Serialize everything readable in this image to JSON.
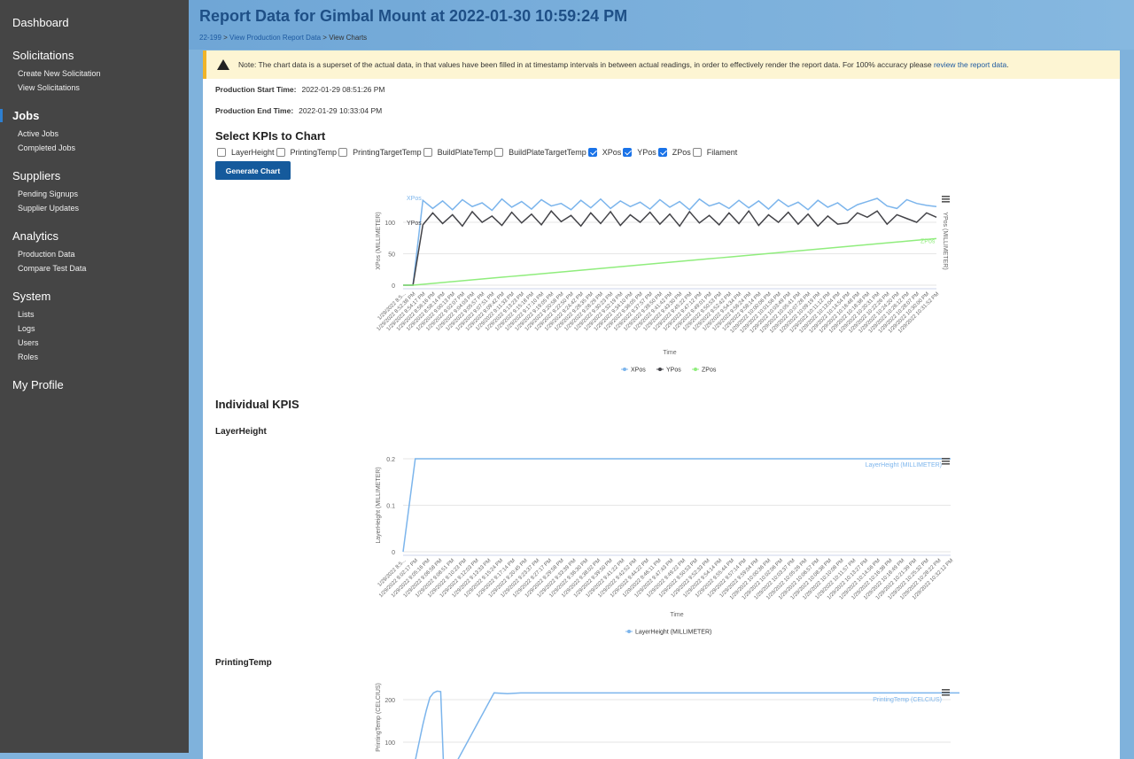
{
  "sidebar": {
    "dashboard": "Dashboard",
    "sections": [
      {
        "title": "Solicitations",
        "items": [
          "Create New Solicitation",
          "View Solicitations"
        ]
      },
      {
        "title": "Jobs",
        "items": [
          "Active Jobs",
          "Completed Jobs"
        ]
      },
      {
        "title": "Suppliers",
        "items": [
          "Pending Signups",
          "Supplier Updates"
        ]
      },
      {
        "title": "Analytics",
        "items": [
          "Production Data",
          "Compare Test Data"
        ]
      },
      {
        "title": "System",
        "items": [
          "Lists",
          "Logs",
          "Users",
          "Roles"
        ]
      }
    ],
    "profile": "My Profile"
  },
  "header": {
    "title": "Report Data for Gimbal Mount at 2022-01-30 10:59:24 PM",
    "breadcrumb": [
      "22-199",
      "View Production Report Data",
      "View Charts"
    ],
    "sep": " > "
  },
  "note": {
    "text": "Note: The chart data is a superset of the actual data, in that values have been filled in at timestamp intervals in between actual readings, in order to effectively render the report data. For 100% accuracy please ",
    "link": "review the report data",
    "end": "."
  },
  "production": {
    "start_label": "Production Start Time:",
    "start": "2022-01-29 08:51:26 PM",
    "end_label": "Production End Time:",
    "end": "2022-01-29 10:33:04 PM"
  },
  "kpi_select": {
    "title": "Select KPIs to Chart",
    "options": [
      {
        "label": "LayerHeight",
        "checked": false
      },
      {
        "label": "PrintingTemp",
        "checked": false
      },
      {
        "label": "PrintingTargetTemp",
        "checked": false
      },
      {
        "label": "BuildPlateTemp",
        "checked": false
      },
      {
        "label": "BuildPlateTargetTemp",
        "checked": false
      },
      {
        "label": "XPos",
        "checked": true
      },
      {
        "label": "YPos",
        "checked": true
      },
      {
        "label": "ZPos",
        "checked": true
      },
      {
        "label": "Filament",
        "checked": false
      }
    ],
    "button": "Generate Chart"
  },
  "individual_title": "Individual KPIS",
  "sections": {
    "layer": "LayerHeight",
    "ptemp": "PrintingTemp"
  },
  "chart_data": [
    {
      "type": "line",
      "xlabel": "Time",
      "ylabel": "XPos (MILLIMETER)",
      "ylabel_right": "YPos (MILLIMETER)",
      "yticks": [
        0,
        50,
        100
      ],
      "ylim": [
        0,
        140
      ],
      "grid": true,
      "legend": "bottom",
      "categories": [
        "1/29/2022 8:5...",
        "1/29/2022 8:52:38 PM",
        "1/29/2022 8:54:17 PM",
        "1/29/2022 8:56:16 PM",
        "1/29/2022 8:58:14 PM",
        "1/29/2022 9:00:13 PM",
        "1/29/2022 9:02:07 PM",
        "1/29/2022 9:04:03 PM",
        "1/29/2022 9:05:57 PM",
        "1/29/2022 9:07:51 PM",
        "1/29/2022 9:09:42 PM",
        "1/29/2022 9:11:33 PM",
        "1/29/2022 9:13:23 PM",
        "1/29/2022 9:15:18 PM",
        "1/29/2022 9:17:10 PM",
        "1/29/2022 9:19:05 PM",
        "1/29/2022 9:20:58 PM",
        "1/29/2022 9:22:50 PM",
        "1/29/2022 9:24:42 PM",
        "1/29/2022 9:26:35 PM",
        "1/29/2022 9:28:29 PM",
        "1/29/2022 9:30:23 PM",
        "1/29/2022 9:32:19 PM",
        "1/29/2022 9:34:10 PM",
        "1/29/2022 9:36:05 PM",
        "1/29/2022 9:37:57 PM",
        "1/29/2022 9:39:50 PM",
        "1/29/2022 9:41:42 PM",
        "1/29/2022 9:43:30 PM",
        "1/29/2022 9:45:22 PM",
        "1/29/2022 9:47:12 PM",
        "1/29/2022 9:49:01 PM",
        "1/29/2022 9:50:53 PM",
        "1/29/2022 9:52:42 PM",
        "1/29/2022 9:54:34 PM",
        "1/29/2022 9:56:24 PM",
        "1/29/2022 9:58:14 PM",
        "1/29/2022 10:00:06 PM",
        "1/29/2022 10:01:56 PM",
        "1/29/2022 10:03:49 PM",
        "1/29/2022 10:05:41 PM",
        "1/29/2022 10:07:28 PM",
        "1/29/2022 10:09:19 PM",
        "1/29/2022 10:11:12 PM",
        "1/29/2022 10:13:04 PM",
        "1/29/2022 10:14:54 PM",
        "1/29/2022 10:16:48 PM",
        "1/29/2022 10:18:38 PM",
        "1/29/2022 10:20:31 PM",
        "1/29/2022 10:22:26 PM",
        "1/29/2022 10:24:20 PM",
        "1/29/2022 10:26:12 PM",
        "1/29/2022 10:28:07 PM",
        "1/29/2022 10:30:00 PM",
        "1/29/2022 10:31:52 PM"
      ],
      "series": [
        {
          "name": "XPos",
          "color": "#7cb5ec",
          "values": [
            0,
            0,
            135,
            122,
            134,
            120,
            136,
            125,
            131,
            119,
            137,
            124,
            133,
            121,
            136,
            126,
            130,
            120,
            135,
            123,
            137,
            122,
            134,
            125,
            132,
            121,
            136,
            124,
            133,
            120,
            137,
            126,
            131,
            122,
            135,
            123,
            134,
            121,
            136,
            125,
            132,
            120,
            135,
            124,
            131,
            119,
            128,
            133,
            138,
            126,
            122,
            136,
            130,
            127,
            125
          ]
        },
        {
          "name": "YPos",
          "color": "#434348",
          "values": [
            0,
            0,
            96,
            115,
            98,
            112,
            94,
            117,
            100,
            110,
            95,
            116,
            99,
            113,
            96,
            118,
            101,
            111,
            94,
            115,
            98,
            117,
            95,
            112,
            100,
            116,
            97,
            113,
            94,
            117,
            99,
            111,
            96,
            115,
            98,
            118,
            95,
            112,
            100,
            116,
            97,
            113,
            94,
            110,
            97,
            99,
            115,
            108,
            118,
            97,
            112,
            106,
            100,
            115,
            108
          ]
        },
        {
          "name": "ZPos",
          "color": "#90ed7d",
          "values": [
            0,
            0,
            1.4,
            2.8,
            4.2,
            5.6,
            7,
            8.4,
            9.8,
            11.2,
            12.6,
            14,
            15.4,
            16.8,
            18.2,
            19.6,
            21,
            22.4,
            23.8,
            25.2,
            26.6,
            28,
            29.4,
            30.8,
            32.2,
            33.6,
            35,
            36.4,
            37.8,
            39.2,
            40.6,
            42,
            43.4,
            44.8,
            46.2,
            47.6,
            49,
            50.4,
            51.8,
            53.2,
            54.6,
            56,
            57.4,
            58.8,
            60.2,
            61.6,
            63,
            64.4,
            65.8,
            67.2,
            68.6,
            70,
            71.4,
            72.8,
            74.2
          ]
        }
      ]
    },
    {
      "type": "line",
      "xlabel": "Time",
      "ylabel": "LayerHeight (MILLIMETER)",
      "yticks": [
        0,
        0.1,
        0.2
      ],
      "ylim": [
        0,
        0.2
      ],
      "grid": true,
      "legend": "bottom",
      "categories": [
        "1/29/2022 8:5...",
        "1/29/2022 9:02:17 PM",
        "1/29/2022 9:05:16 PM",
        "1/29/2022 9:06:58 PM",
        "1/29/2022 9:08:51 PM",
        "1/29/2022 9:10:23 PM",
        "1/29/2022 9:12:03 PM",
        "1/29/2022 9:13:33 PM",
        "1/29/2022 9:15:24 PM",
        "1/29/2022 9:17:14 PM",
        "1/29/2022 9:20:45 PM",
        "1/29/2022 9:23:37 PM",
        "1/29/2022 9:27:17 PM",
        "1/29/2022 9:29:58 PM",
        "1/29/2022 9:33:39 PM",
        "1/29/2022 9:36:30 PM",
        "1/29/2022 9:38:02 PM",
        "1/29/2022 9:39:50 PM",
        "1/29/2022 9:41:22 PM",
        "1/29/2022 9:42:52 PM",
        "1/29/2022 9:44:22 PM",
        "1/29/2022 9:46:11 PM",
        "1/29/2022 9:47:43 PM",
        "1/29/2022 9:49:22 PM",
        "1/29/2022 9:50:53 PM",
        "1/29/2022 9:52:33 PM",
        "1/29/2022 9:54:14 PM",
        "1/29/2022 9:55:44 PM",
        "1/29/2022 9:57:14 PM",
        "1/29/2022 9:59:04 PM",
        "1/29/2022 10:00:36 PM",
        "1/29/2022 10:02:06 PM",
        "1/29/2022 10:03:37 PM",
        "1/29/2022 10:05:26 PM",
        "1/29/2022 10:06:57 PM",
        "1/29/2022 10:08:38 PM",
        "1/29/2022 10:10:08 PM",
        "1/29/2022 10:11:57 PM",
        "1/29/2022 10:13:27 PM",
        "1/29/2022 10:14:56 PM",
        "1/29/2022 10:16:38 PM",
        "1/29/2022 10:18:49 PM",
        "1/29/2022 10:21:39 PM",
        "1/29/2022 10:25:32 PM",
        "1/29/2022 10:28:22 PM",
        "1/29/2022 10:32:12 PM"
      ],
      "series": [
        {
          "name": "LayerHeight (MILLIMETER)",
          "color": "#7cb5ec",
          "values": [
            0,
            0.2,
            0.2,
            0.2,
            0.2,
            0.2,
            0.2,
            0.2,
            0.2,
            0.2,
            0.2,
            0.2,
            0.2,
            0.2,
            0.2,
            0.2,
            0.2,
            0.2,
            0.2,
            0.2,
            0.2,
            0.2,
            0.2,
            0.2,
            0.2,
            0.2,
            0.2,
            0.2,
            0.2,
            0.2,
            0.2,
            0.2,
            0.2,
            0.2,
            0.2,
            0.2,
            0.2,
            0.2,
            0.2,
            0.2,
            0.2,
            0.2,
            0.2,
            0.2,
            0.2,
            0.2
          ]
        }
      ]
    },
    {
      "type": "line",
      "ylabel": "PrintingTemp (CELCIUS)",
      "yticks": [
        100,
        200
      ],
      "grid": true,
      "series": [
        {
          "name": "PrintingTemp (CELCIUS)",
          "color": "#7cb5ec",
          "values": [
            20,
            60,
            100,
            140,
            175,
            205,
            216,
            220,
            219,
            0,
            216,
            214,
            216,
            216,
            216,
            216,
            216,
            216,
            216,
            216,
            216,
            216,
            216,
            216,
            216,
            216,
            216,
            216,
            216,
            216,
            216,
            216,
            216,
            216,
            216,
            216,
            216,
            216,
            216,
            216,
            216,
            216,
            216,
            216,
            216,
            216
          ]
        }
      ]
    }
  ]
}
